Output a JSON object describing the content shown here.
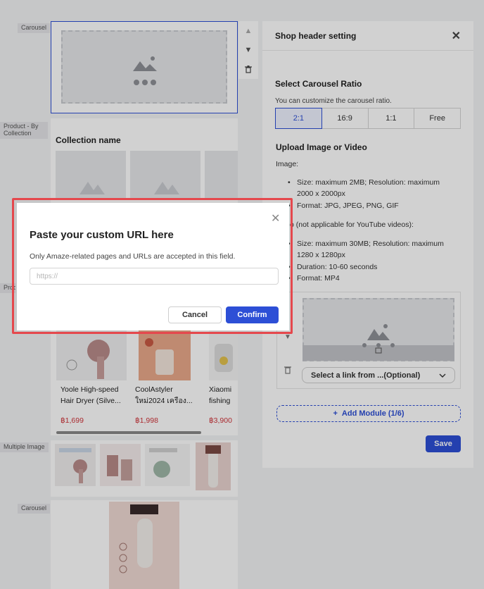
{
  "canvas": {
    "labels": {
      "carousel_1": "Carousel",
      "product_by_collection": "Product - By Collection",
      "product_partial": "Produ Coll",
      "multiple_image": "Multiple Image",
      "carousel_2": "Carousel"
    },
    "collection_name": "Collection name",
    "products": [
      {
        "name_line1": "Yoole High-speed",
        "name_line2": "Hair Dryer (Silve...",
        "price": "฿1,699"
      },
      {
        "name_line1": "CoolAstyler",
        "name_line2": "ใหม่2024 เครือง...",
        "price": "฿1,998"
      },
      {
        "name_line1": "Xiaomi",
        "name_line2": "fishing",
        "price": "฿3,900"
      }
    ]
  },
  "panel": {
    "title": "Shop header setting",
    "ratio_title": "Select Carousel Ratio",
    "ratio_sub": "You can customize the carousel ratio.",
    "ratios": [
      "2:1",
      "16:9",
      "1:1",
      "Free"
    ],
    "ratio_selected": "2:1",
    "upload_title": "Upload Image or Video",
    "image_label": "Image:",
    "image_bullets": [
      "Size: maximum 2MB; Resolution: maximum",
      "2000 x 2000px",
      "Format: JPG, JPEG, PNG, GIF"
    ],
    "video_label": "o (not applicable for YouTube videos):",
    "video_bullets": [
      "Size: maximum 30MB; Resolution: maximum",
      "1280 x 1280px",
      "Duration: 10-60 seconds",
      "Format: MP4"
    ],
    "link_select": "Select a link from ...(Optional)",
    "add_module": "Add Module (1/6)",
    "save": "Save"
  },
  "modal": {
    "title": "Paste your custom URL here",
    "description": "Only Amaze-related pages and URLs are accepted in this field.",
    "input_placeholder": "https://",
    "input_value": "",
    "cancel": "Cancel",
    "confirm": "Confirm"
  },
  "colors": {
    "accent": "#2d4fd6",
    "price": "#d0343a",
    "highlight": "#e5484d"
  }
}
